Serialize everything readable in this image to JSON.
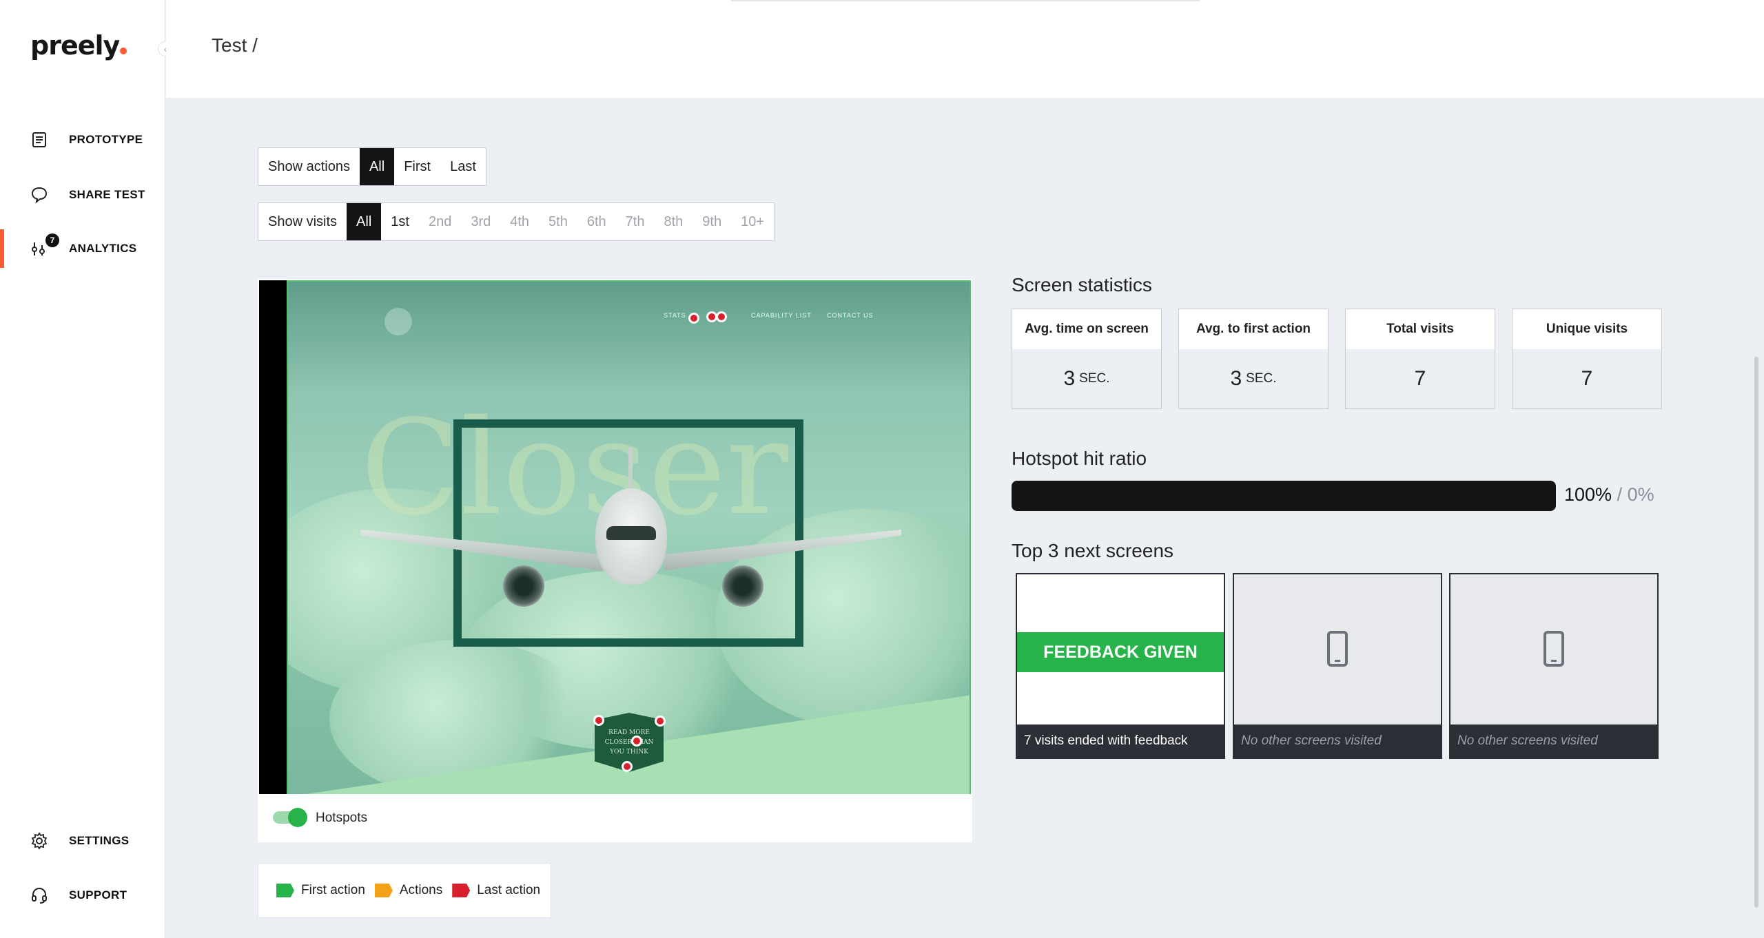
{
  "app": {
    "logo": "preely",
    "collapse_icon": "chevron-left-icon"
  },
  "sidebar": {
    "items": [
      {
        "label": "PROTOTYPE",
        "icon": "document-icon"
      },
      {
        "label": "SHARE TEST",
        "icon": "chat-bubble-icon"
      },
      {
        "label": "ANALYTICS",
        "icon": "analytics-icon",
        "badge": "7",
        "active": true
      }
    ],
    "bottom_items": [
      {
        "label": "SETTINGS",
        "icon": "gear-icon"
      },
      {
        "label": "SUPPORT",
        "icon": "headset-icon"
      }
    ]
  },
  "header": {
    "title": "Test /"
  },
  "filters": {
    "actions": {
      "label": "Show actions",
      "options": [
        "All",
        "First",
        "Last"
      ],
      "selected": "All"
    },
    "visits": {
      "label": "Show visits",
      "options": [
        "All",
        "1st",
        "2nd",
        "3rd",
        "4th",
        "5th",
        "6th",
        "7th",
        "8th",
        "9th",
        "10+"
      ],
      "selected": "All"
    }
  },
  "preview": {
    "nav_links": [
      "STATS",
      "CAPABILITY LIST",
      "CONTACT US"
    ],
    "big_word": "Closer",
    "badge_lines": [
      "READ MORE",
      "CLOSER THAN",
      "YOU THINK"
    ],
    "hotspots_label": "Hotspots",
    "hotspots_on": true
  },
  "legend": [
    {
      "label": "First action",
      "color": "#27b24a"
    },
    {
      "label": "Actions",
      "color": "#f4a11a"
    },
    {
      "label": "Last action",
      "color": "#d8202c"
    }
  ],
  "screen_statistics": {
    "title": "Screen statistics",
    "cards": [
      {
        "label": "Avg. time on screen",
        "value": "3",
        "unit": "SEC."
      },
      {
        "label": "Avg. to first action",
        "value": "3",
        "unit": "SEC."
      },
      {
        "label": "Total visits",
        "value": "7",
        "unit": ""
      },
      {
        "label": "Unique visits",
        "value": "7",
        "unit": ""
      }
    ]
  },
  "hotspot_hit_ratio": {
    "title": "Hotspot hit ratio",
    "hit": "100%",
    "miss": "/ 0%",
    "hit_fraction": 1.0
  },
  "top_next_screens": {
    "title": "Top 3 next screens",
    "screens": [
      {
        "banner": "FEEDBACK GIVEN",
        "caption": "7 visits ended with feedback"
      },
      {
        "caption": "No other screens visited",
        "icon": "phone-icon"
      },
      {
        "caption": "No other screens visited",
        "icon": "phone-icon"
      }
    ]
  },
  "colors": {
    "accent": "#ff5a36",
    "success": "#27b24a",
    "dark": "#141414"
  }
}
